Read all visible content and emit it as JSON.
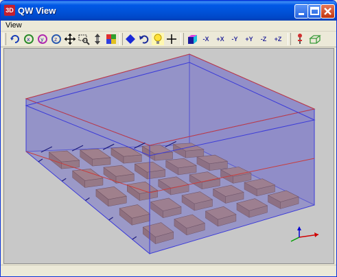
{
  "window": {
    "app_icon_text": "3D",
    "title": "QW View"
  },
  "menu": {
    "items": [
      "View"
    ]
  },
  "toolbar": {
    "icons": [
      "rotate-icon",
      "rotate-x-icon",
      "rotate-y-icon",
      "rotate-z-icon",
      "pan-icon",
      "zoom-window-icon",
      "zoom-icon",
      "color-palette-icon",
      "diamond-icon",
      "undo-icon",
      "light-bulb-icon",
      "crosshair-icon",
      "cube-icon",
      "view-minus-x-icon",
      "view-plus-x-icon",
      "view-minus-y-icon",
      "view-plus-y-icon",
      "view-minus-z-icon",
      "view-plus-z-icon",
      "probe-icon",
      "box-outline-icon"
    ],
    "axis_labels": [
      "-X",
      "+X",
      "-Y",
      "+Y",
      "-Z",
      "+Z"
    ]
  },
  "colors": {
    "titlebar": "#0058e6",
    "viewport_bg": "#c8c8c8",
    "dielectric_fill": "#7b79c8",
    "dielectric_edge_blue": "#3b3bd8",
    "dielectric_edge_red": "#c83c3c",
    "patch_fill": "#b4846c",
    "axis_x": "#d00000",
    "axis_y": "#00a000",
    "axis_z": "#0000d0"
  }
}
